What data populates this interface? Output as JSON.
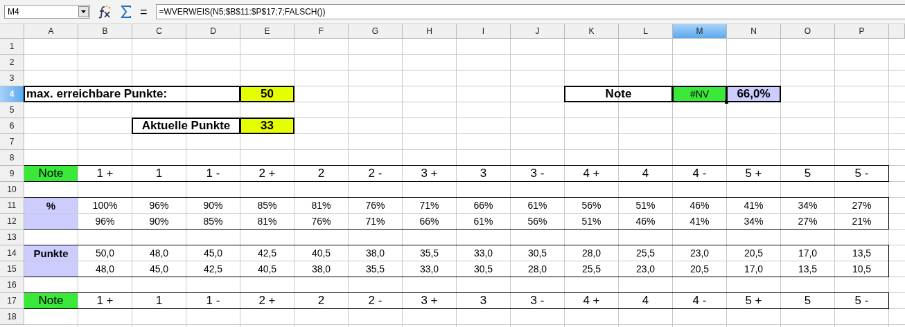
{
  "toolbar": {
    "name_box": "M4",
    "equals": "=",
    "formula": "=WVERWEIS(N5;$B$11:$P$17;7;FALSCH())"
  },
  "columns": [
    {
      "label": "A",
      "selected": false
    },
    {
      "label": "B",
      "selected": false
    },
    {
      "label": "C",
      "selected": false
    },
    {
      "label": "D",
      "selected": false
    },
    {
      "label": "E",
      "selected": false
    },
    {
      "label": "F",
      "selected": false
    },
    {
      "label": "G",
      "selected": false
    },
    {
      "label": "H",
      "selected": false
    },
    {
      "label": "I",
      "selected": false
    },
    {
      "label": "J",
      "selected": false
    },
    {
      "label": "K",
      "selected": false
    },
    {
      "label": "L",
      "selected": false
    },
    {
      "label": "M",
      "selected": true
    },
    {
      "label": "N",
      "selected": false
    },
    {
      "label": "O",
      "selected": false
    },
    {
      "label": "P",
      "selected": false
    }
  ],
  "rows": [
    {
      "number": "1",
      "selected": false,
      "cells": []
    },
    {
      "number": "2",
      "selected": false,
      "cells": []
    },
    {
      "number": "3",
      "selected": false,
      "cells": []
    },
    {
      "number": "4",
      "selected": true,
      "cells": [
        {
          "text": "max. erreichbare Punkte:",
          "kind": "label",
          "left_aligned": true,
          "boxed": true
        },
        {
          "covered": true
        },
        {
          "covered": true
        },
        {
          "covered": true
        },
        {
          "text": "50",
          "kind": "label",
          "boxed": true,
          "color": "#e6ff00"
        },
        null,
        null,
        null,
        null,
        null,
        {
          "text": "Note",
          "kind": "label",
          "boxed": true
        },
        {
          "covered": true
        },
        {
          "text": "#NV",
          "kind": "value",
          "boxed": true,
          "color": "#3ae83a",
          "selected": true
        },
        {
          "text": "66,0%",
          "kind": "label",
          "boxed": true,
          "color": "#ccccff"
        }
      ]
    },
    {
      "number": "5",
      "selected": false,
      "cells": []
    },
    {
      "number": "6",
      "selected": false,
      "cells": [
        null,
        null,
        {
          "text": "Aktuelle Punkte",
          "kind": "label",
          "boxed": true
        },
        {
          "covered": true
        },
        {
          "text": "33",
          "kind": "label",
          "boxed": true,
          "color": "#e6ff00"
        }
      ]
    },
    {
      "number": "7",
      "selected": false,
      "cells": []
    },
    {
      "number": "8",
      "selected": false,
      "cells": []
    },
    {
      "number": "9",
      "selected": false,
      "border_top": true,
      "border_bottom": true,
      "cells": [
        {
          "text": "Note",
          "kind": "grade",
          "color": "#3ae83a"
        },
        {
          "text": "1 +",
          "kind": "grade"
        },
        {
          "text": "1",
          "kind": "grade"
        },
        {
          "text": "1 -",
          "kind": "grade"
        },
        {
          "text": "2 +",
          "kind": "grade"
        },
        {
          "text": "2",
          "kind": "grade"
        },
        {
          "text": "2 -",
          "kind": "grade"
        },
        {
          "text": "3 +",
          "kind": "grade"
        },
        {
          "text": "3",
          "kind": "grade"
        },
        {
          "text": "3 -",
          "kind": "grade"
        },
        {
          "text": "4 +",
          "kind": "grade"
        },
        {
          "text": "4",
          "kind": "grade"
        },
        {
          "text": "4 -",
          "kind": "grade"
        },
        {
          "text": "5 +",
          "kind": "grade"
        },
        {
          "text": "5",
          "kind": "grade"
        },
        {
          "text": "5 -",
          "kind": "grade"
        }
      ]
    },
    {
      "number": "10",
      "selected": false,
      "cells": []
    },
    {
      "number": "11",
      "selected": false,
      "border_top": true,
      "cells": [
        {
          "text": "%",
          "kind": "tag",
          "color": "#ccccff"
        },
        {
          "text": "100%",
          "kind": "value"
        },
        {
          "text": "96%",
          "kind": "value"
        },
        {
          "text": "90%",
          "kind": "value"
        },
        {
          "text": "85%",
          "kind": "value"
        },
        {
          "text": "81%",
          "kind": "value"
        },
        {
          "text": "76%",
          "kind": "value"
        },
        {
          "text": "71%",
          "kind": "value"
        },
        {
          "text": "66%",
          "kind": "value"
        },
        {
          "text": "61%",
          "kind": "value"
        },
        {
          "text": "56%",
          "kind": "value"
        },
        {
          "text": "51%",
          "kind": "value"
        },
        {
          "text": "46%",
          "kind": "value"
        },
        {
          "text": "41%",
          "kind": "value"
        },
        {
          "text": "34%",
          "kind": "value"
        },
        {
          "text": "27%",
          "kind": "value"
        }
      ]
    },
    {
      "number": "12",
      "selected": false,
      "border_bottom": true,
      "cells": [
        {
          "color": "#ccccff"
        },
        {
          "text": "96%",
          "kind": "value"
        },
        {
          "text": "90%",
          "kind": "value"
        },
        {
          "text": "85%",
          "kind": "value"
        },
        {
          "text": "81%",
          "kind": "value"
        },
        {
          "text": "76%",
          "kind": "value"
        },
        {
          "text": "71%",
          "kind": "value"
        },
        {
          "text": "66%",
          "kind": "value"
        },
        {
          "text": "61%",
          "kind": "value"
        },
        {
          "text": "56%",
          "kind": "value"
        },
        {
          "text": "51%",
          "kind": "value"
        },
        {
          "text": "46%",
          "kind": "value"
        },
        {
          "text": "41%",
          "kind": "value"
        },
        {
          "text": "34%",
          "kind": "value"
        },
        {
          "text": "27%",
          "kind": "value"
        },
        {
          "text": "21%",
          "kind": "value"
        }
      ]
    },
    {
      "number": "13",
      "selected": false,
      "cells": []
    },
    {
      "number": "14",
      "selected": false,
      "border_top": true,
      "cells": [
        {
          "text": "Punkte",
          "kind": "tag",
          "color": "#ccccff"
        },
        {
          "text": "50,0",
          "kind": "value"
        },
        {
          "text": "48,0",
          "kind": "value"
        },
        {
          "text": "45,0",
          "kind": "value"
        },
        {
          "text": "42,5",
          "kind": "value"
        },
        {
          "text": "40,5",
          "kind": "value"
        },
        {
          "text": "38,0",
          "kind": "value"
        },
        {
          "text": "35,5",
          "kind": "value"
        },
        {
          "text": "33,0",
          "kind": "value"
        },
        {
          "text": "30,5",
          "kind": "value"
        },
        {
          "text": "28,0",
          "kind": "value"
        },
        {
          "text": "25,5",
          "kind": "value"
        },
        {
          "text": "23,0",
          "kind": "value"
        },
        {
          "text": "20,5",
          "kind": "value"
        },
        {
          "text": "17,0",
          "kind": "value"
        },
        {
          "text": "13,5",
          "kind": "value"
        }
      ]
    },
    {
      "number": "15",
      "selected": false,
      "border_bottom": true,
      "cells": [
        {
          "color": "#ccccff"
        },
        {
          "text": "48,0",
          "kind": "value"
        },
        {
          "text": "45,0",
          "kind": "value"
        },
        {
          "text": "42,5",
          "kind": "value"
        },
        {
          "text": "40,5",
          "kind": "value"
        },
        {
          "text": "38,0",
          "kind": "value"
        },
        {
          "text": "35,5",
          "kind": "value"
        },
        {
          "text": "33,0",
          "kind": "value"
        },
        {
          "text": "30,5",
          "kind": "value"
        },
        {
          "text": "28,0",
          "kind": "value"
        },
        {
          "text": "25,5",
          "kind": "value"
        },
        {
          "text": "23,0",
          "kind": "value"
        },
        {
          "text": "20,5",
          "kind": "value"
        },
        {
          "text": "17,0",
          "kind": "value"
        },
        {
          "text": "13,5",
          "kind": "value"
        },
        {
          "text": "10,5",
          "kind": "value"
        }
      ]
    },
    {
      "number": "16",
      "selected": false,
      "cells": []
    },
    {
      "number": "17",
      "selected": false,
      "border_top": true,
      "border_bottom": true,
      "cells": [
        {
          "text": "Note",
          "kind": "grade",
          "color": "#3ae83a"
        },
        {
          "text": "1 +",
          "kind": "grade"
        },
        {
          "text": "1",
          "kind": "grade"
        },
        {
          "text": "1 -",
          "kind": "grade"
        },
        {
          "text": "2 +",
          "kind": "grade"
        },
        {
          "text": "2",
          "kind": "grade"
        },
        {
          "text": "2 -",
          "kind": "grade"
        },
        {
          "text": "3 +",
          "kind": "grade"
        },
        {
          "text": "3",
          "kind": "grade"
        },
        {
          "text": "3 -",
          "kind": "grade"
        },
        {
          "text": "4 +",
          "kind": "grade"
        },
        {
          "text": "4",
          "kind": "grade"
        },
        {
          "text": "4 -",
          "kind": "grade"
        },
        {
          "text": "5 +",
          "kind": "grade"
        },
        {
          "text": "5",
          "kind": "grade"
        },
        {
          "text": "5 -",
          "kind": "grade"
        }
      ]
    },
    {
      "number": "18",
      "selected": false,
      "cells": []
    }
  ]
}
